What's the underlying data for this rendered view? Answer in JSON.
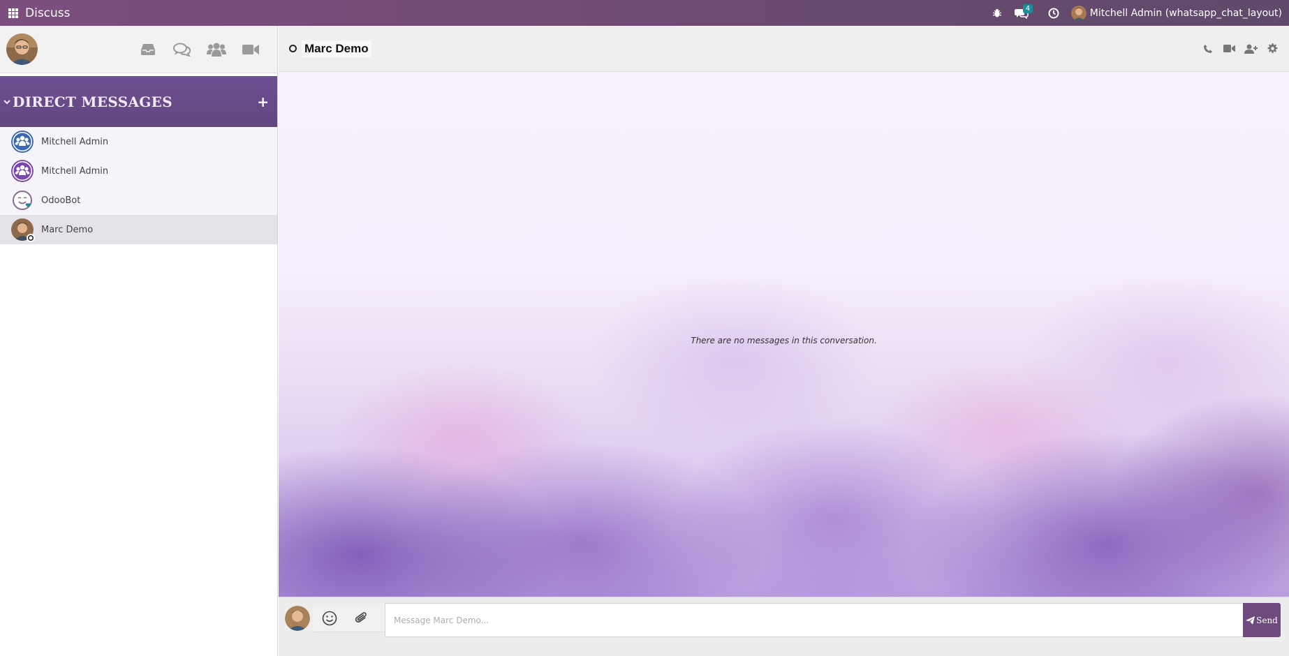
{
  "navbar": {
    "app_name": "Discuss",
    "message_count": "4",
    "user_label": "Mitchell Admin (whatsapp_chat_layout)"
  },
  "sidebar": {
    "section_title": "DIRECT MESSAGES",
    "add_label": "+",
    "items": [
      {
        "name": "Mitchell Admin",
        "avatar": "group-avatar-blue"
      },
      {
        "name": "Mitchell Admin",
        "avatar": "group-avatar-purple"
      },
      {
        "name": "OdooBot",
        "avatar": "odoobot-avatar"
      },
      {
        "name": "Marc Demo",
        "avatar": "user-photo",
        "active": true
      }
    ]
  },
  "thread": {
    "title": "Marc Demo",
    "empty_message": "There are no messages in this conversation."
  },
  "composer": {
    "placeholder": "Message Marc Demo...",
    "send_label": "Send"
  },
  "colors": {
    "navbar": "#714b73",
    "sidebar_header": "#6e4f93",
    "send_button": "#6f4a7e",
    "badge": "#1c8c99"
  }
}
